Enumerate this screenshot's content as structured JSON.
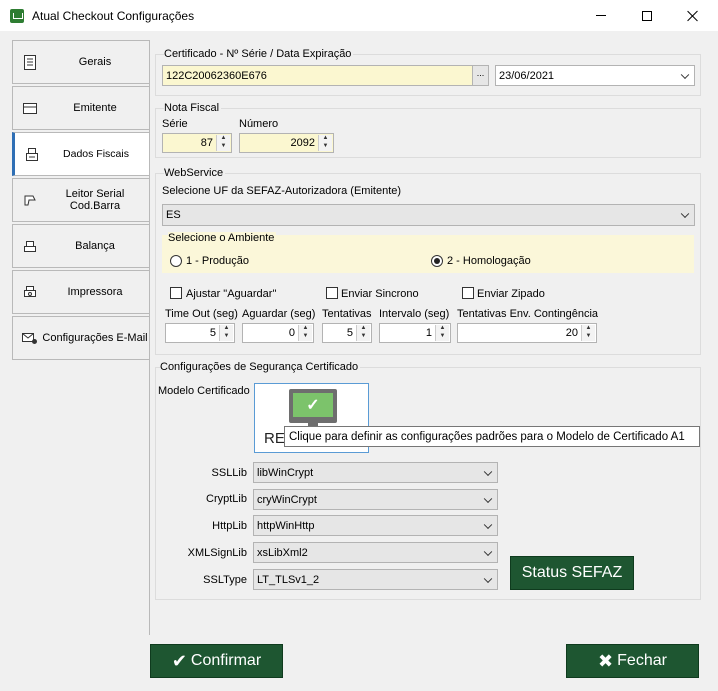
{
  "window": {
    "title": "Atual Checkout Configurações"
  },
  "nav": {
    "items": [
      {
        "label": "Gerais",
        "icon": "document-icon"
      },
      {
        "label": "Emitente",
        "icon": "card-icon"
      },
      {
        "label": "Dados Fiscais",
        "icon": "cash-register-icon",
        "active": true
      },
      {
        "label": "Leitor Serial Cod.Barra",
        "icon": "barcode-scanner-icon"
      },
      {
        "label": "Balança",
        "icon": "scale-icon"
      },
      {
        "label": "Impressora",
        "icon": "printer-icon"
      },
      {
        "label": "Configurações E-Mail",
        "icon": "email-settings-icon"
      }
    ]
  },
  "certificado": {
    "group_label": "Certificado - Nº Série / Data Expiração",
    "serial": "122C20062360E676",
    "browse_label": "...",
    "expiration": "23/06/2021"
  },
  "nota_fiscal": {
    "group_label": "Nota Fiscal",
    "serie_label": "Série",
    "serie_value": "87",
    "numero_label": "Número",
    "numero_value": "2092"
  },
  "webservice": {
    "group_label": "WebService",
    "uf_label": "Selecione UF da SEFAZ-Autorizadora (Emitente)",
    "uf_value": "ES",
    "ambiente_label": "Selecione o Ambiente",
    "ambiente_options": [
      "1 - Produção",
      "2 - Homologação"
    ],
    "ambiente_selected": "2 - Homologação",
    "checkboxes": {
      "ajustar": "Ajustar \"Aguardar\"",
      "sincrono": "Enviar Sincrono",
      "zipado": "Enviar Zipado"
    },
    "timeout_label": "Time Out (seg)",
    "timeout_value": "5",
    "aguardar_label": "Aguardar (seg)",
    "aguardar_value": "0",
    "tentativas_label": "Tentativas",
    "tentativas_value": "5",
    "intervalo_label": "Intervalo (seg)",
    "intervalo_value": "1",
    "contingencia_label": "Tentativas Env. Contingência",
    "contingencia_value": "20"
  },
  "seguranca": {
    "group_label": "Configurações de Segurança Certificado",
    "modelo_label": "Modelo Certificado",
    "cert_label_visible": "RE",
    "tooltip": "Clique para definir as configurações padrões  para o Modelo de Certificado A1",
    "ssllib_label": "SSLLib",
    "ssllib_value": "libWinCrypt",
    "cryptlib_label": "CryptLib",
    "cryptlib_value": "cryWinCrypt",
    "httplib_label": "HttpLib",
    "httplib_value": "httpWinHttp",
    "xmlsignlib_label": "XMLSignLib",
    "xmlsignlib_value": "xsLibXml2",
    "ssltype_label": "SSLType",
    "ssltype_value": "LT_TLSv1_2",
    "status_button": "Status SEFAZ"
  },
  "footer": {
    "confirm_label": "Confirmar",
    "close_label": "Fechar"
  }
}
